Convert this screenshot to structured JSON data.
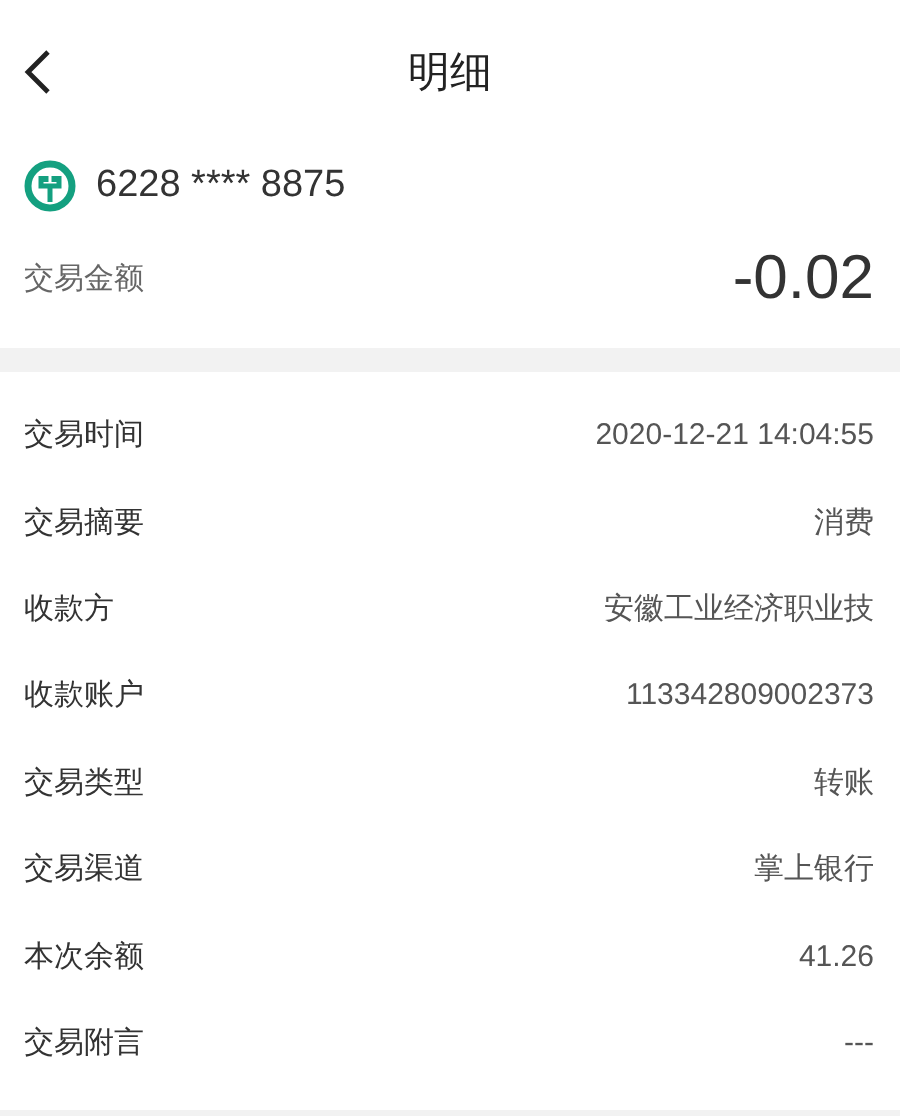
{
  "header": {
    "title": "明细"
  },
  "account": {
    "number": "6228 **** 8875"
  },
  "amount": {
    "label": "交易金额",
    "value": "-0.02"
  },
  "details": [
    {
      "label": "交易时间",
      "value": "2020-12-21 14:04:55"
    },
    {
      "label": "交易摘要",
      "value": "消费"
    },
    {
      "label": "收款方",
      "value": "安徽工业经济职业技"
    },
    {
      "label": "收款账户",
      "value": "113342809002373"
    },
    {
      "label": "交易类型",
      "value": "转账"
    },
    {
      "label": "交易渠道",
      "value": "掌上银行"
    },
    {
      "label": "本次余额",
      "value": "41.26"
    },
    {
      "label": "交易附言",
      "value": "---"
    }
  ]
}
